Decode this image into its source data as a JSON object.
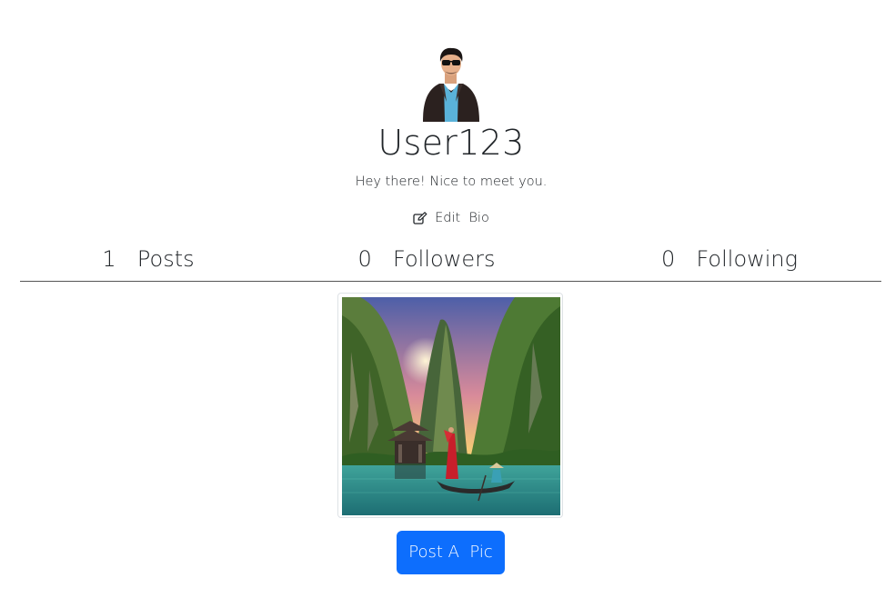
{
  "profile": {
    "username": "User123",
    "bio": "Hey there!  Nice to meet you.",
    "edit_bio_label": "Edit  Bio",
    "avatar_icon": "user-avatar-icon",
    "edit_icon": "edit-icon"
  },
  "stats": {
    "posts": "1  Posts",
    "followers": "0  Followers",
    "following": "0  Following"
  },
  "posts": [
    {
      "alt": "Karst mountains lake with pagoda and boat"
    }
  ],
  "actions": {
    "post_button_label": "Post A  Pic"
  },
  "colors": {
    "accent": "#0d6efd",
    "text": "#212529",
    "divider": "#555555"
  }
}
